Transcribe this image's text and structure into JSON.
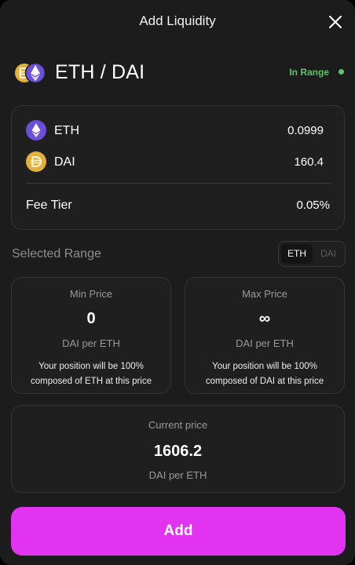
{
  "modal": {
    "title": "Add Liquidity"
  },
  "pair": {
    "name": "ETH / DAI",
    "range_status": "In Range",
    "range_status_color": "#5fc46a"
  },
  "amounts": {
    "tokens": [
      {
        "symbol": "ETH",
        "amount": "0.0999",
        "icon": "eth-icon",
        "color": "#6b4fd6"
      },
      {
        "symbol": "DAI",
        "amount": "160.4",
        "icon": "dai-icon",
        "color": "#e3b13d"
      }
    ],
    "fee_tier_label": "Fee Tier",
    "fee_tier_value": "0.05%"
  },
  "range": {
    "label": "Selected Range",
    "toggle": {
      "active": "ETH",
      "inactive": "DAI"
    },
    "min": {
      "label": "Min Price",
      "value": "0",
      "unit": "DAI per ETH",
      "note": "Your position will be 100% composed of ETH at this price"
    },
    "max": {
      "label": "Max Price",
      "value": "∞",
      "unit": "DAI per ETH",
      "note": "Your position will be 100% composed of DAI at this price"
    }
  },
  "current": {
    "label": "Current price",
    "value": "1606.2",
    "unit": "DAI per ETH"
  },
  "actions": {
    "add_label": "Add",
    "accent_color": "#e133f0"
  }
}
